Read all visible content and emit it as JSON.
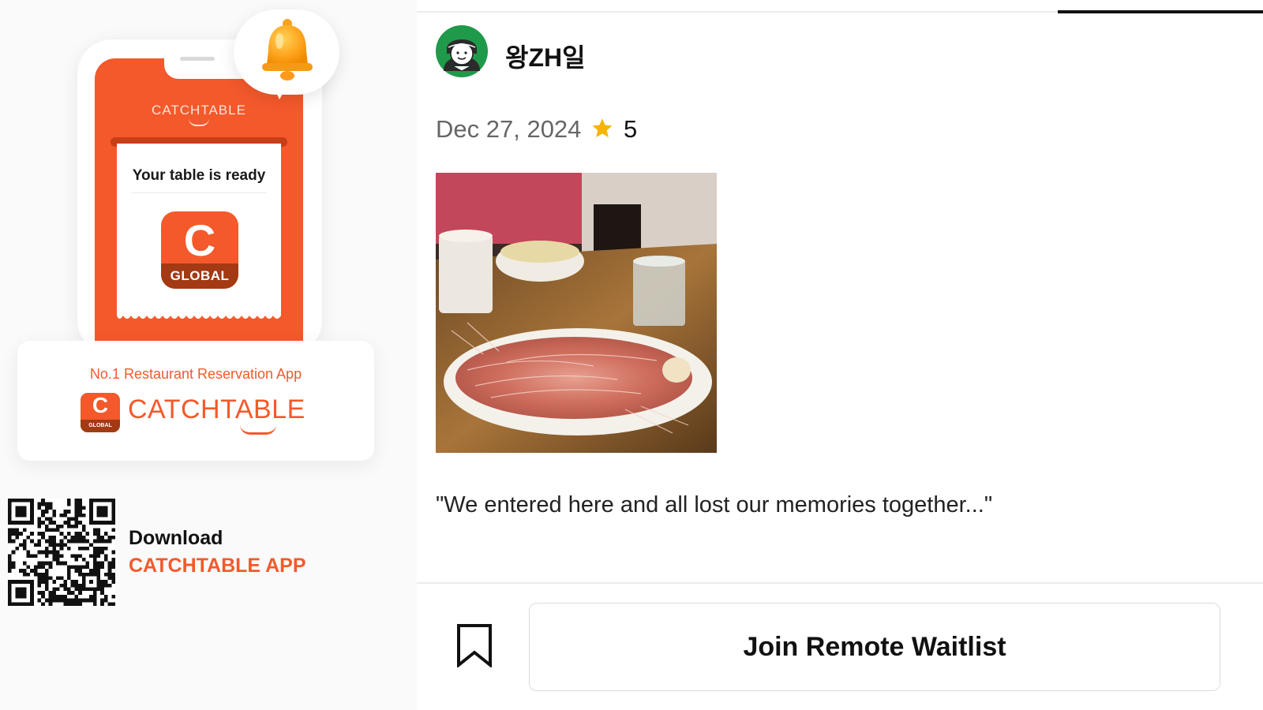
{
  "promo": {
    "phone_brand": "CATCHTABLE",
    "ticket_title": "Your table is ready",
    "app_icon_letter": "C",
    "app_icon_band": "GLOBAL",
    "bell_icon": "bell-icon",
    "tagline": "No.1 Restaurant Reservation App",
    "logo_icon_letter": "C",
    "logo_icon_band": "GLOBAL",
    "wordmark": "CATCHTABLE",
    "download_label": "Download",
    "download_app": "CATCHTABLE APP",
    "brand_color": "#f4592b"
  },
  "review": {
    "reviewer_name": "왕ZH일",
    "avatar_icon": "avatar-icon",
    "date": "Dec 27, 2024",
    "rating": "5",
    "rating_icon": "star-icon",
    "star_color": "#f5b400",
    "photo": "shrimp-dish-photo",
    "quote": "\"We entered here and all lost our memories together...\""
  },
  "actions": {
    "bookmark_icon": "bookmark-icon",
    "waitlist_label": "Join Remote Waitlist"
  }
}
